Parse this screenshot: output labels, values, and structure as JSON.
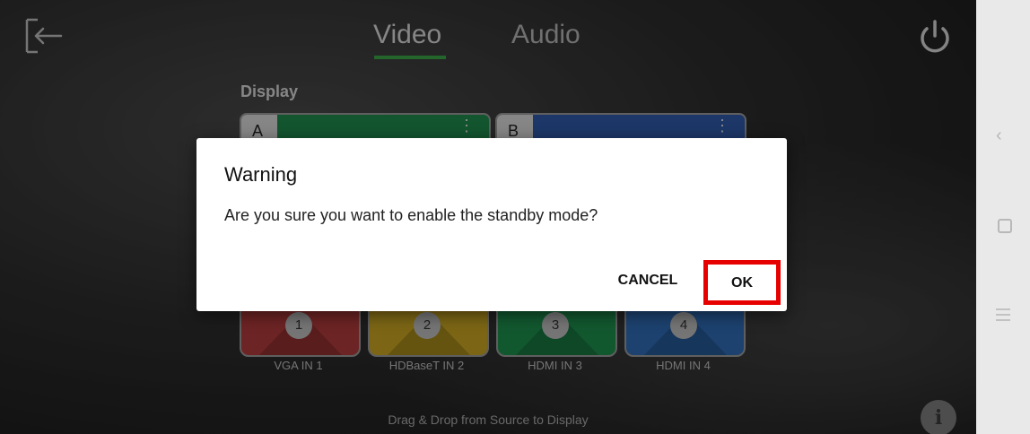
{
  "tabs": {
    "video": "Video",
    "audio": "Audio"
  },
  "display": {
    "label": "Display",
    "tiles": [
      {
        "letter": "A",
        "color": "#1f8a4c"
      },
      {
        "letter": "B",
        "color": "#2e5aa8"
      }
    ]
  },
  "sources": [
    {
      "number": "1",
      "label": "VGA IN 1",
      "color": "#b03a3a"
    },
    {
      "number": "2",
      "label": "HDBaseT IN 2",
      "color": "#c8a522"
    },
    {
      "number": "3",
      "label": "HDMI IN 3",
      "color": "#1e8e4d"
    },
    {
      "number": "4",
      "label": "HDMI IN 4",
      "color": "#2f6bb5"
    }
  ],
  "hint": "Drag & Drop from Source to Display",
  "info_icon": "i",
  "dialog": {
    "title": "Warning",
    "message": "Are you sure you want to enable the standby mode?",
    "cancel": "CANCEL",
    "ok": "OK",
    "highlight_color": "#e60000"
  },
  "colors": {
    "accent": "#3ba347"
  },
  "icons": {
    "back": "back-arrow-icon",
    "power": "power-icon",
    "more": "more-vert-icon",
    "nav_back": "chevron-left-icon",
    "nav_home": "square-home-icon",
    "nav_menu": "menu-lines-icon"
  }
}
